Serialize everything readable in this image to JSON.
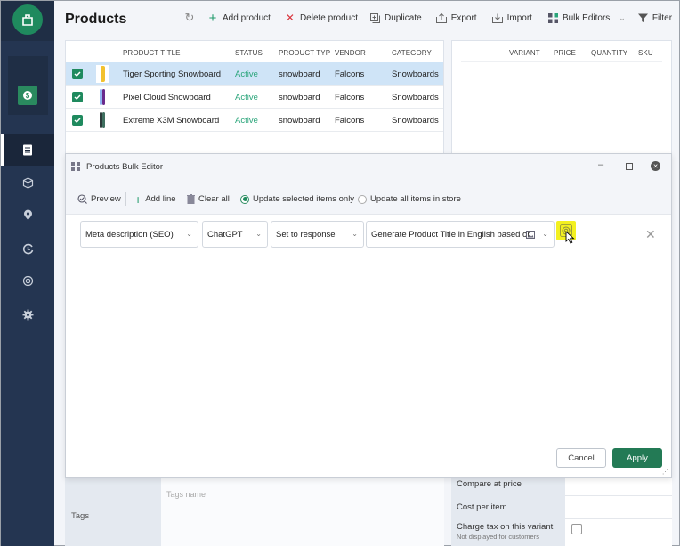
{
  "header": {
    "title": "Products"
  },
  "toolbar": {
    "refresh_icon": "refresh-icon",
    "items": [
      {
        "label": "Add product",
        "icon": "plus-icon"
      },
      {
        "label": "Delete product",
        "icon": "x-icon"
      },
      {
        "label": "Duplicate",
        "icon": "duplicate-icon"
      },
      {
        "label": "Export",
        "icon": "export-icon"
      },
      {
        "label": "Import",
        "icon": "import-icon"
      },
      {
        "label": "Bulk Editors",
        "icon": "grid-icon"
      },
      {
        "label": "Filter",
        "icon": "filter-icon"
      }
    ]
  },
  "sidebar": {
    "items": [
      {
        "name": "products",
        "icon": "document-icon",
        "active": true
      },
      {
        "name": "inventory",
        "icon": "box-icon"
      },
      {
        "name": "locations",
        "icon": "location-pin-icon"
      },
      {
        "name": "history",
        "icon": "history-icon"
      },
      {
        "name": "ai",
        "icon": "openai-icon"
      },
      {
        "name": "settings",
        "icon": "gear-icon"
      }
    ]
  },
  "products_table": {
    "columns": [
      "PRODUCT TITLE",
      "STATUS",
      "PRODUCT TYP",
      "VENDOR",
      "CATEGORY"
    ],
    "rows": [
      {
        "title": "Tiger Sporting Snowboard",
        "status": "Active",
        "type": "snowboard",
        "vendor": "Falcons",
        "category": "Snowboards",
        "selected": true,
        "checked": true
      },
      {
        "title": "Pixel Cloud Snowboard",
        "status": "Active",
        "type": "snowboard",
        "vendor": "Falcons",
        "category": "Snowboards",
        "selected": false,
        "checked": true
      },
      {
        "title": "Extreme X3M Snowboard",
        "status": "Active",
        "type": "snowboard",
        "vendor": "Falcons",
        "category": "Snowboards",
        "selected": false,
        "checked": true
      }
    ]
  },
  "variants_table": {
    "columns": [
      "VARIANT",
      "PRICE",
      "QUANTITY",
      "SKU"
    ]
  },
  "bulk_editor": {
    "title": "Products Bulk Editor",
    "toolbar": {
      "preview": "Preview",
      "add_line": "Add line",
      "clear_all": "Clear all",
      "radio_selected": "Update selected items only",
      "radio_all": "Update all items in store",
      "selected_option": "Update selected items only"
    },
    "line": {
      "field": "Meta description (SEO)",
      "provider": "ChatGPT",
      "action": "Set to response",
      "prompt": "Generate Product Title in English based or"
    },
    "cancel": "Cancel",
    "apply": "Apply"
  },
  "bottom": {
    "tags_label": "Tags",
    "tags_placeholder": "Tags name",
    "compare_at_price": "Compare at price",
    "cost_per_item": "Cost per item",
    "charge_tax": "Charge tax on this variant",
    "charge_tax_note": "Not displayed for customers"
  },
  "colors": {
    "brand": "#1f8a5e",
    "sidebar": "#243551",
    "selected_row": "#cfe4f7",
    "apply": "#237a55",
    "highlight": "#f3f020"
  }
}
